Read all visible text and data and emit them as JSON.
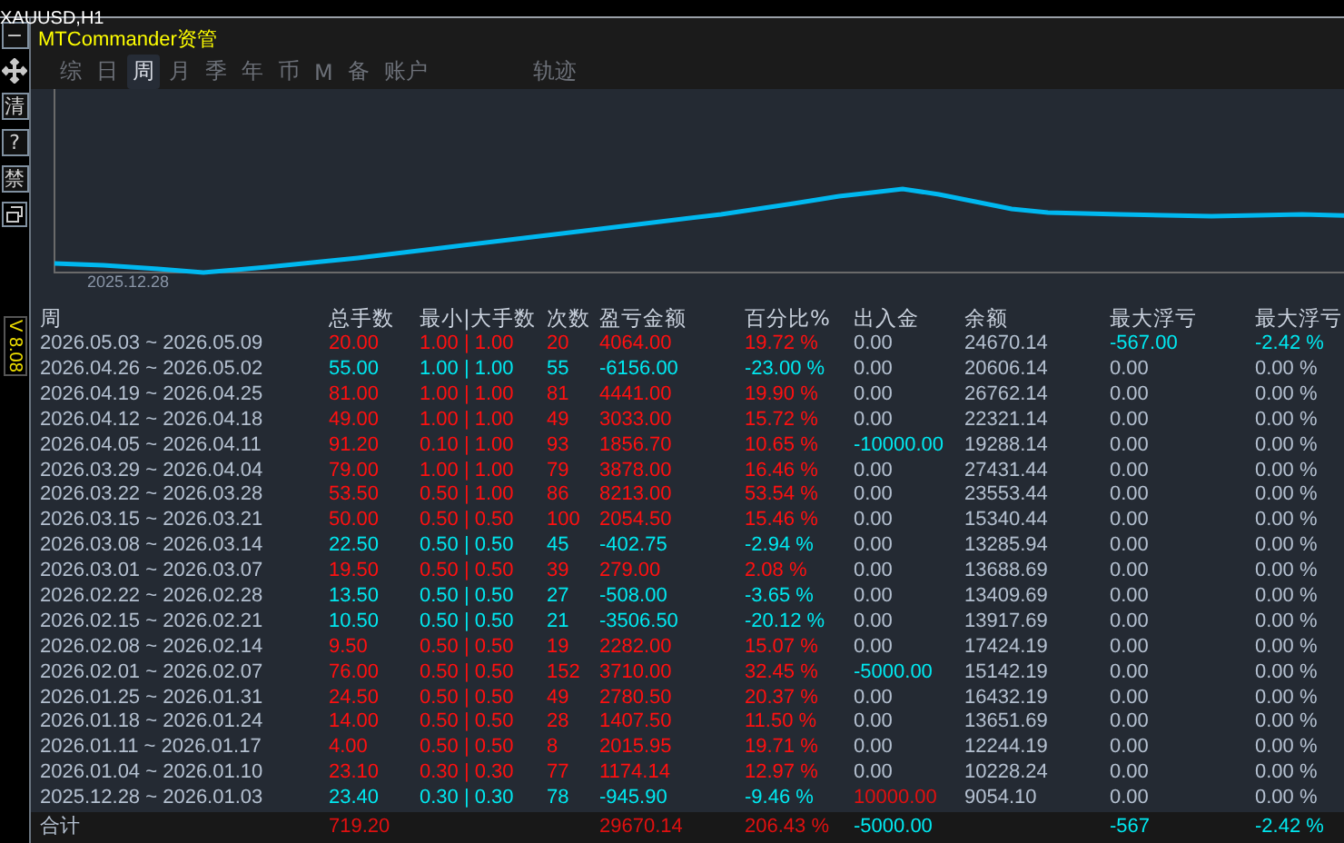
{
  "chart_window": {
    "symbol": "XAUUSD,H1",
    "version": "V 8.08"
  },
  "side_buttons": [
    {
      "kind": "text",
      "label": "−"
    },
    {
      "kind": "move"
    },
    {
      "kind": "text",
      "label": "清"
    },
    {
      "kind": "text",
      "label": "?"
    },
    {
      "kind": "text",
      "label": "禁"
    },
    {
      "kind": "window"
    }
  ],
  "panel": {
    "title": "MTCommander资管"
  },
  "tabs": [
    {
      "label": "综",
      "selected": false
    },
    {
      "label": "日",
      "selected": false
    },
    {
      "label": "周",
      "selected": true
    },
    {
      "label": "月",
      "selected": false
    },
    {
      "label": "季",
      "selected": false
    },
    {
      "label": "年",
      "selected": false
    },
    {
      "label": "币",
      "selected": false
    },
    {
      "label": "M",
      "selected": false
    },
    {
      "label": "备",
      "selected": false
    },
    {
      "label": "账户",
      "selected": false
    },
    {
      "label": "轨迹",
      "selected": false
    }
  ],
  "equity_chart": {
    "start_label": "2025.12.28"
  },
  "table": {
    "columns": [
      "周",
      "总手数",
      "最小|大手数",
      "次数",
      "盈亏金额",
      "百分比%",
      "出入金",
      "余额",
      "最大浮亏",
      "最大浮亏"
    ],
    "rows": [
      {
        "week": "2026.05.03 ~ 2026.05.09",
        "color": "#ff1010",
        "lots": "20.00",
        "min_max": "1.00 | 1.00",
        "count": "20",
        "pnl": "4064.00",
        "percent": "19.72 %",
        "flow": {
          "text": "0.00",
          "color": "#b4c0d0"
        },
        "balance": "24670.14",
        "max_float": {
          "text": "-567.00",
          "color": "#00e8f0"
        },
        "max_float_pct": {
          "text": "-2.42 %",
          "color": "#00e8f0"
        }
      },
      {
        "week": "2026.04.26 ~ 2026.05.02",
        "color": "#00e8f0",
        "lots": "55.00",
        "min_max": "1.00 | 1.00",
        "count": "55",
        "pnl": "-6156.00",
        "percent": "-23.00 %",
        "flow": {
          "text": "0.00",
          "color": "#b4c0d0"
        },
        "balance": "20606.14",
        "max_float": {
          "text": "0.00",
          "color": "#b4c0d0"
        },
        "max_float_pct": {
          "text": "0.00 %",
          "color": "#b4c0d0"
        }
      },
      {
        "week": "2026.04.19 ~ 2026.04.25",
        "color": "#ff1010",
        "lots": "81.00",
        "min_max": "1.00 | 1.00",
        "count": "81",
        "pnl": "4441.00",
        "percent": "19.90 %",
        "flow": {
          "text": "0.00",
          "color": "#b4c0d0"
        },
        "balance": "26762.14",
        "max_float": {
          "text": "0.00",
          "color": "#b4c0d0"
        },
        "max_float_pct": {
          "text": "0.00 %",
          "color": "#b4c0d0"
        }
      },
      {
        "week": "2026.04.12 ~ 2026.04.18",
        "color": "#ff1010",
        "lots": "49.00",
        "min_max": "1.00 | 1.00",
        "count": "49",
        "pnl": "3033.00",
        "percent": "15.72 %",
        "flow": {
          "text": "0.00",
          "color": "#b4c0d0"
        },
        "balance": "22321.14",
        "max_float": {
          "text": "0.00",
          "color": "#b4c0d0"
        },
        "max_float_pct": {
          "text": "0.00 %",
          "color": "#b4c0d0"
        }
      },
      {
        "week": "2026.04.05 ~ 2026.04.11",
        "color": "#ff1010",
        "lots": "91.20",
        "min_max": "0.10 | 1.00",
        "count": "93",
        "pnl": "1856.70",
        "percent": "10.65 %",
        "flow": {
          "text": "-10000.00",
          "color": "#00e8f0"
        },
        "balance": "19288.14",
        "max_float": {
          "text": "0.00",
          "color": "#b4c0d0"
        },
        "max_float_pct": {
          "text": "0.00 %",
          "color": "#b4c0d0"
        }
      },
      {
        "week": "2026.03.29 ~ 2026.04.04",
        "color": "#ff1010",
        "lots": "79.00",
        "min_max": "1.00 | 1.00",
        "count": "79",
        "pnl": "3878.00",
        "percent": "16.46 %",
        "flow": {
          "text": "0.00",
          "color": "#b4c0d0"
        },
        "balance": "27431.44",
        "max_float": {
          "text": "0.00",
          "color": "#b4c0d0"
        },
        "max_float_pct": {
          "text": "0.00 %",
          "color": "#b4c0d0"
        }
      },
      {
        "week": "2026.03.22 ~ 2026.03.28",
        "color": "#ff1010",
        "lots": "53.50",
        "min_max": "0.50 | 1.00",
        "count": "86",
        "pnl": "8213.00",
        "percent": "53.54 %",
        "flow": {
          "text": "0.00",
          "color": "#b4c0d0"
        },
        "balance": "23553.44",
        "max_float": {
          "text": "0.00",
          "color": "#b4c0d0"
        },
        "max_float_pct": {
          "text": "0.00 %",
          "color": "#b4c0d0"
        }
      },
      {
        "week": "2026.03.15 ~ 2026.03.21",
        "color": "#ff1010",
        "lots": "50.00",
        "min_max": "0.50 | 0.50",
        "count": "100",
        "pnl": "2054.50",
        "percent": "15.46 %",
        "flow": {
          "text": "0.00",
          "color": "#b4c0d0"
        },
        "balance": "15340.44",
        "max_float": {
          "text": "0.00",
          "color": "#b4c0d0"
        },
        "max_float_pct": {
          "text": "0.00 %",
          "color": "#b4c0d0"
        }
      },
      {
        "week": "2026.03.08 ~ 2026.03.14",
        "color": "#00e8f0",
        "lots": "22.50",
        "min_max": "0.50 | 0.50",
        "count": "45",
        "pnl": "-402.75",
        "percent": "-2.94 %",
        "flow": {
          "text": "0.00",
          "color": "#b4c0d0"
        },
        "balance": "13285.94",
        "max_float": {
          "text": "0.00",
          "color": "#b4c0d0"
        },
        "max_float_pct": {
          "text": "0.00 %",
          "color": "#b4c0d0"
        }
      },
      {
        "week": "2026.03.01 ~ 2026.03.07",
        "color": "#ff1010",
        "lots": "19.50",
        "min_max": "0.50 | 0.50",
        "count": "39",
        "pnl": "279.00",
        "percent": "2.08 %",
        "flow": {
          "text": "0.00",
          "color": "#b4c0d0"
        },
        "balance": "13688.69",
        "max_float": {
          "text": "0.00",
          "color": "#b4c0d0"
        },
        "max_float_pct": {
          "text": "0.00 %",
          "color": "#b4c0d0"
        }
      },
      {
        "week": "2026.02.22 ~ 2026.02.28",
        "color": "#00e8f0",
        "lots": "13.50",
        "min_max": "0.50 | 0.50",
        "count": "27",
        "pnl": "-508.00",
        "percent": "-3.65 %",
        "flow": {
          "text": "0.00",
          "color": "#b4c0d0"
        },
        "balance": "13409.69",
        "max_float": {
          "text": "0.00",
          "color": "#b4c0d0"
        },
        "max_float_pct": {
          "text": "0.00 %",
          "color": "#b4c0d0"
        }
      },
      {
        "week": "2026.02.15 ~ 2026.02.21",
        "color": "#00e8f0",
        "lots": "10.50",
        "min_max": "0.50 | 0.50",
        "count": "21",
        "pnl": "-3506.50",
        "percent": "-20.12 %",
        "flow": {
          "text": "0.00",
          "color": "#b4c0d0"
        },
        "balance": "13917.69",
        "max_float": {
          "text": "0.00",
          "color": "#b4c0d0"
        },
        "max_float_pct": {
          "text": "0.00 %",
          "color": "#b4c0d0"
        }
      },
      {
        "week": "2026.02.08 ~ 2026.02.14",
        "color": "#ff1010",
        "lots": "9.50",
        "min_max": "0.50 | 0.50",
        "count": "19",
        "pnl": "2282.00",
        "percent": "15.07 %",
        "flow": {
          "text": "0.00",
          "color": "#b4c0d0"
        },
        "balance": "17424.19",
        "max_float": {
          "text": "0.00",
          "color": "#b4c0d0"
        },
        "max_float_pct": {
          "text": "0.00 %",
          "color": "#b4c0d0"
        }
      },
      {
        "week": "2026.02.01 ~ 2026.02.07",
        "color": "#ff1010",
        "lots": "76.00",
        "min_max": "0.50 | 0.50",
        "count": "152",
        "pnl": "3710.00",
        "percent": "32.45 %",
        "flow": {
          "text": "-5000.00",
          "color": "#00e8f0"
        },
        "balance": "15142.19",
        "max_float": {
          "text": "0.00",
          "color": "#b4c0d0"
        },
        "max_float_pct": {
          "text": "0.00 %",
          "color": "#b4c0d0"
        }
      },
      {
        "week": "2026.01.25 ~ 2026.01.31",
        "color": "#ff1010",
        "lots": "24.50",
        "min_max": "0.50 | 0.50",
        "count": "49",
        "pnl": "2780.50",
        "percent": "20.37 %",
        "flow": {
          "text": "0.00",
          "color": "#b4c0d0"
        },
        "balance": "16432.19",
        "max_float": {
          "text": "0.00",
          "color": "#b4c0d0"
        },
        "max_float_pct": {
          "text": "0.00 %",
          "color": "#b4c0d0"
        }
      },
      {
        "week": "2026.01.18 ~ 2026.01.24",
        "color": "#ff1010",
        "lots": "14.00",
        "min_max": "0.50 | 0.50",
        "count": "28",
        "pnl": "1407.50",
        "percent": "11.50 %",
        "flow": {
          "text": "0.00",
          "color": "#b4c0d0"
        },
        "balance": "13651.69",
        "max_float": {
          "text": "0.00",
          "color": "#b4c0d0"
        },
        "max_float_pct": {
          "text": "0.00 %",
          "color": "#b4c0d0"
        }
      },
      {
        "week": "2026.01.11 ~ 2026.01.17",
        "color": "#ff1010",
        "lots": "4.00",
        "min_max": "0.50 | 0.50",
        "count": "8",
        "pnl": "2015.95",
        "percent": "19.71 %",
        "flow": {
          "text": "0.00",
          "color": "#b4c0d0"
        },
        "balance": "12244.19",
        "max_float": {
          "text": "0.00",
          "color": "#b4c0d0"
        },
        "max_float_pct": {
          "text": "0.00 %",
          "color": "#b4c0d0"
        }
      },
      {
        "week": "2026.01.04 ~ 2026.01.10",
        "color": "#ff1010",
        "lots": "23.10",
        "min_max": "0.30 | 0.30",
        "count": "77",
        "pnl": "1174.14",
        "percent": "12.97 %",
        "flow": {
          "text": "0.00",
          "color": "#b4c0d0"
        },
        "balance": "10228.24",
        "max_float": {
          "text": "0.00",
          "color": "#b4c0d0"
        },
        "max_float_pct": {
          "text": "0.00 %",
          "color": "#b4c0d0"
        }
      },
      {
        "week": "2025.12.28 ~ 2026.01.03",
        "color": "#00e8f0",
        "lots": "23.40",
        "min_max": "0.30 | 0.30",
        "count": "78",
        "pnl": "-945.90",
        "percent": "-9.46 %",
        "flow": {
          "text": "10000.00",
          "color": "#e01010"
        },
        "balance": "9054.10",
        "max_float": {
          "text": "0.00",
          "color": "#b4c0d0"
        },
        "max_float_pct": {
          "text": "0.00 %",
          "color": "#b4c0d0"
        }
      }
    ],
    "total": {
      "label": "合计",
      "lots": "719.20",
      "pnl": "29670.14",
      "percent": "206.43 %",
      "flow": "-5000.00",
      "max_float": "-567",
      "max_float_pct": "-2.42 %"
    }
  }
}
